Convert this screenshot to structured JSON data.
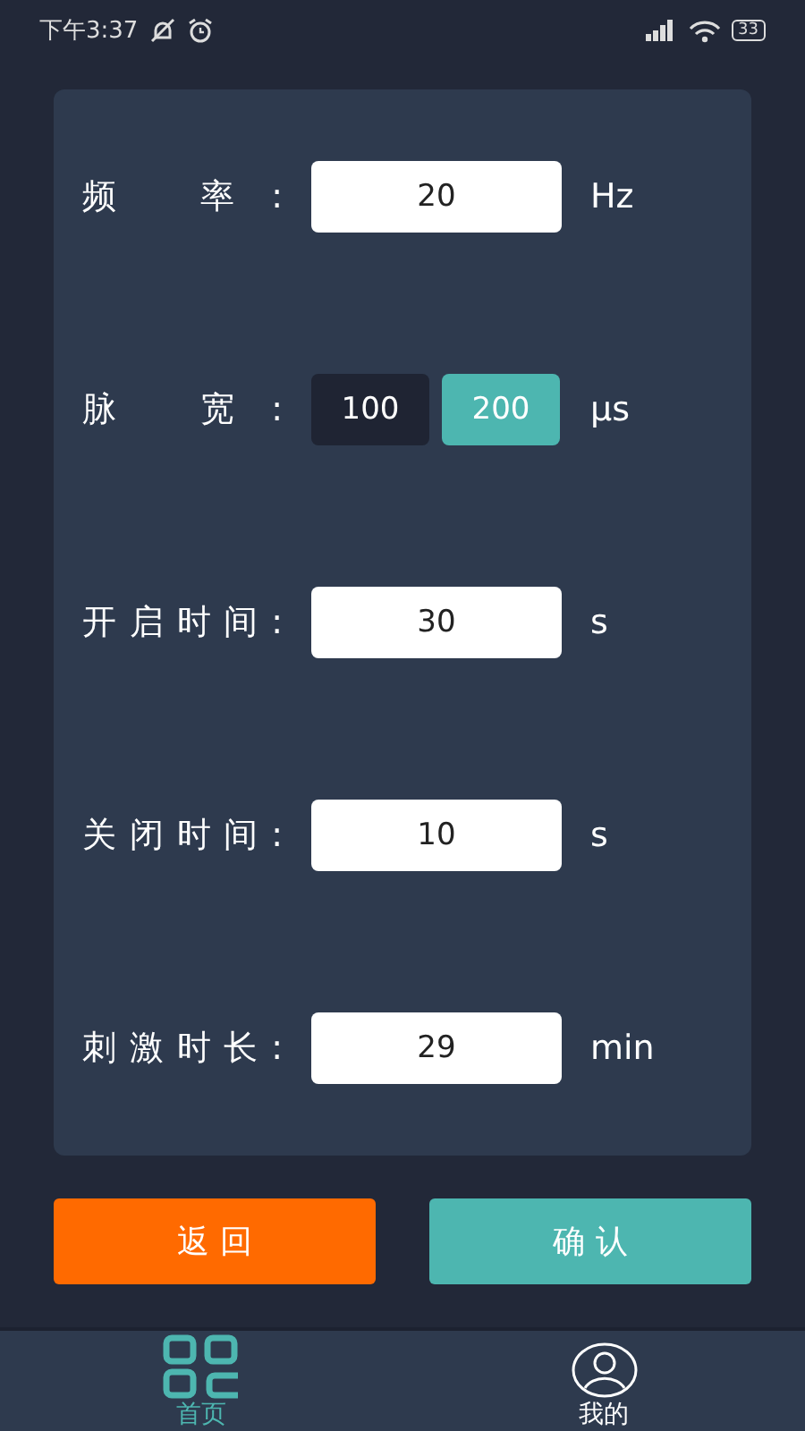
{
  "status_bar": {
    "time": "下午3:37",
    "battery": "33"
  },
  "settings": [
    {
      "kind": "input",
      "label": "频 率:",
      "value": "20",
      "unit": "Hz"
    },
    {
      "kind": "choice",
      "label": "脉 宽:",
      "options": [
        {
          "label": "100",
          "selected": false
        },
        {
          "label": "200",
          "selected": true
        }
      ],
      "unit": "μs"
    },
    {
      "kind": "input",
      "label": "开启时间:",
      "value": "30",
      "unit": "s"
    },
    {
      "kind": "input",
      "label": "关闭时间:",
      "value": "10",
      "unit": "s"
    },
    {
      "kind": "input",
      "label": "刺激时长:",
      "value": "29",
      "unit": "min"
    }
  ],
  "buttons": [
    {
      "kind": "back",
      "label": "返 回"
    },
    {
      "kind": "confirm",
      "label": "确 认"
    }
  ],
  "nav": [
    {
      "kind": "home",
      "label": "首页",
      "selected": true
    },
    {
      "kind": "profile",
      "label": "我的",
      "selected": false
    }
  ]
}
